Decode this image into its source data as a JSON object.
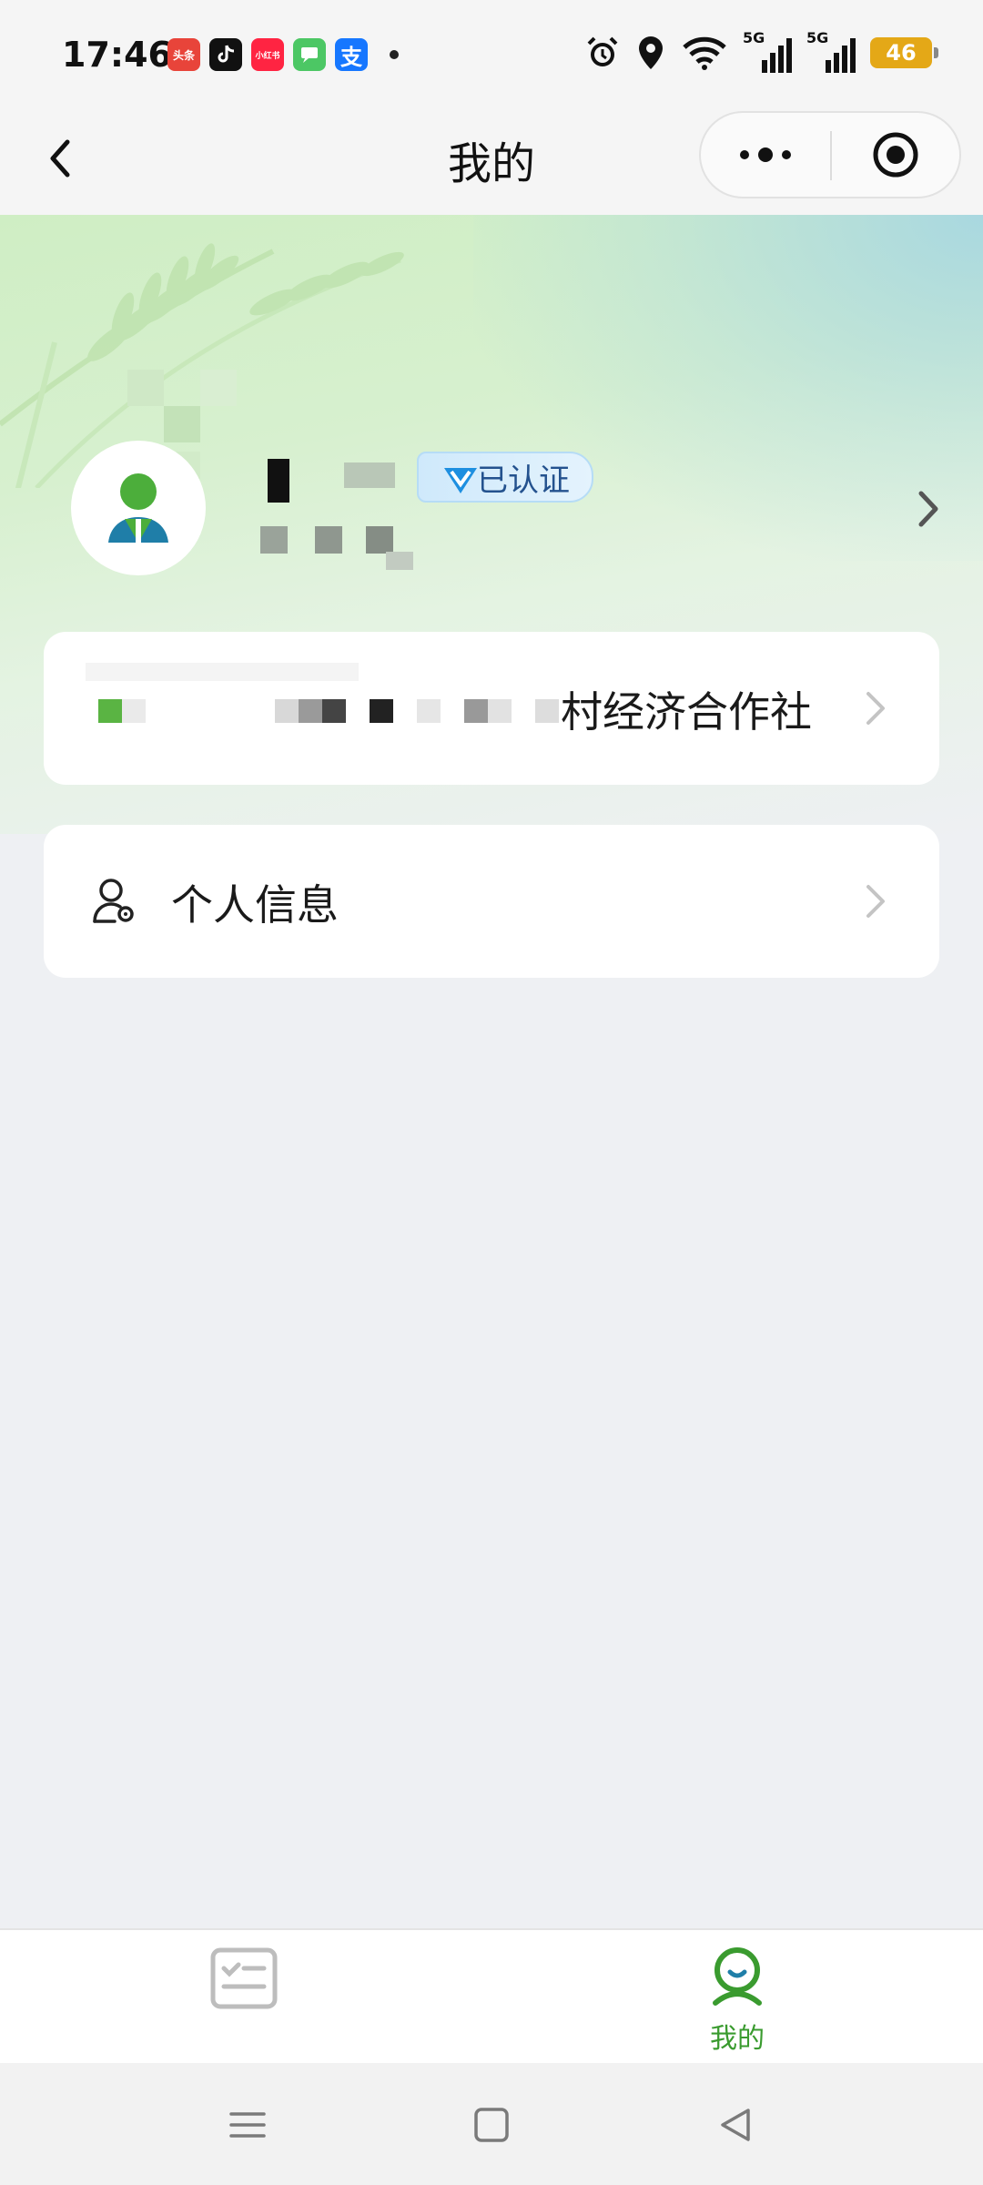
{
  "status_bar": {
    "time": "17:46",
    "apps": [
      {
        "name": "toutiao-icon",
        "label": "头条",
        "color": "#e8443a"
      },
      {
        "name": "douyin-icon",
        "label": "",
        "color": "#111111"
      },
      {
        "name": "xiaohongshu-icon",
        "label": "小红书",
        "color": "#ff2442"
      },
      {
        "name": "messages-icon",
        "label": "",
        "color": "#4cc764"
      },
      {
        "name": "alipay-icon",
        "label": "支",
        "color": "#1677ff"
      }
    ],
    "signal_1": "5G",
    "signal_2": "5G",
    "battery": "46"
  },
  "nav": {
    "title": "我的"
  },
  "profile": {
    "verified_label": "已认证"
  },
  "coop_card": {
    "label": "村经济合作社"
  },
  "info_card": {
    "label": "个人信息"
  },
  "tabs": [
    {
      "label": "",
      "active": false
    },
    {
      "label": "我的",
      "active": true
    }
  ],
  "colors": {
    "accent": "#3a9b2f",
    "verified_text": "#24528e",
    "background": "#eef0f3"
  }
}
